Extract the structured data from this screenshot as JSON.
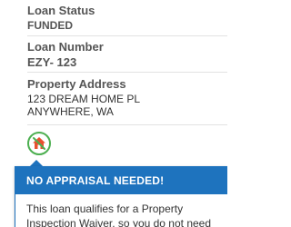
{
  "loan_status": {
    "label": "Loan Status",
    "value": "FUNDED"
  },
  "loan_number": {
    "label": "Loan Number",
    "value": "EZY- 123"
  },
  "property_address": {
    "label": "Property Address",
    "line1": "123 DREAM HOME  PL",
    "line2": "ANYWHERE, WA"
  },
  "house_icon": {
    "name": "no-appraisal-house-icon",
    "ring_color": "#4caf50",
    "house_color": "#e8502f"
  },
  "popover": {
    "title": "NO APPRAISAL NEEDED!",
    "body_line1": "This loan qualifies for a Property",
    "body_line2": "Inspection Waiver, so you do not need",
    "accent_color": "#1e73be"
  }
}
